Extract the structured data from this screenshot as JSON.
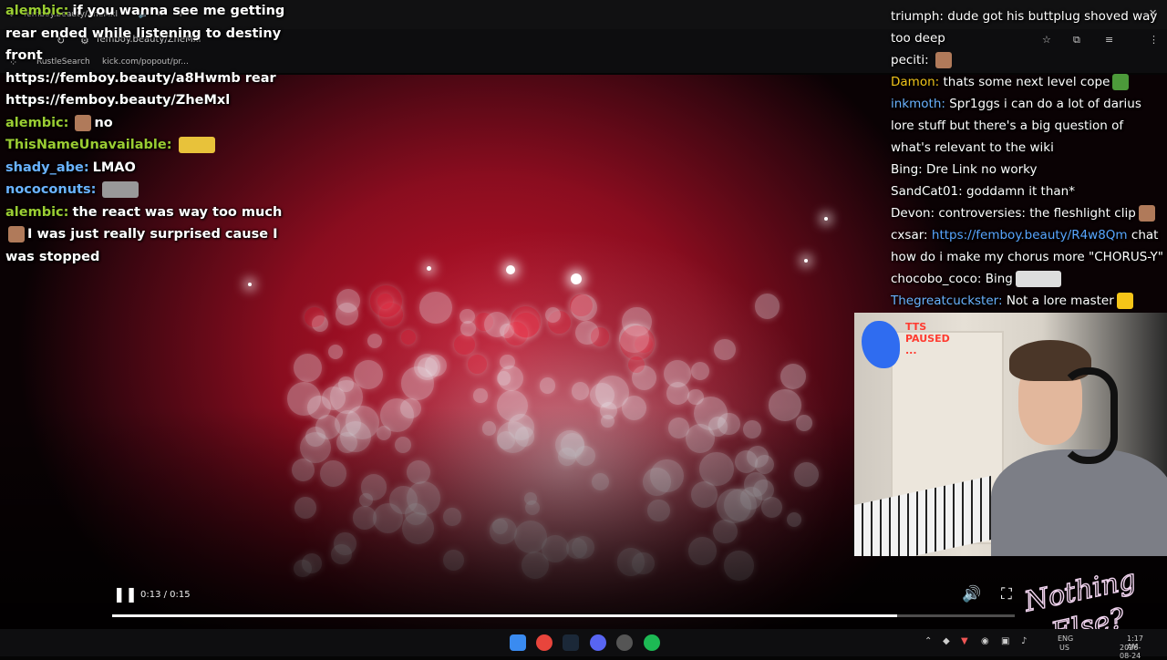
{
  "browser": {
    "tab_title": "femboy.beauty/ZheMxl",
    "url": "femboy.beauty/ZheMxl",
    "bookmarks": [
      "RustleSearch",
      "kick.com/popout/pr..."
    ]
  },
  "left_chat": [
    {
      "user": "alembic:",
      "user_color": "#9acd32",
      "text": "if you wanna see me getting rear ended while listening to destiny front",
      "emote": null
    },
    {
      "user": "",
      "user_color": "#ffffff",
      "text": "https://femboy.beauty/a8Hwmb rear https://femboy.beauty/ZheMxl",
      "emote": null
    },
    {
      "user": "alembic:",
      "user_color": "#9acd32",
      "text": "no",
      "emote": "face-emote"
    },
    {
      "user": "ThisNameUnavailable:",
      "user_color": "#9acd32",
      "text": "",
      "emote": "car-emote"
    },
    {
      "user": "shady_abe:",
      "user_color": "#6ab3ff",
      "text": "LMAO",
      "emote": null
    },
    {
      "user": "nococonuts:",
      "user_color": "#6ab3ff",
      "text": "",
      "emote": "wave-emote"
    },
    {
      "user": "alembic:",
      "user_color": "#9acd32",
      "text": "the react was way too much",
      "emote": null
    },
    {
      "user": "",
      "user_color": "#ffffff",
      "text": "I was just really surprised cause I was stopped",
      "emote": "face-emote"
    }
  ],
  "right_chat": [
    {
      "user": "triumph:",
      "user_color": "#ffffff",
      "text": "dude got his buttplug shoved way too deep",
      "link": ""
    },
    {
      "user": "peciti:",
      "user_color": "#ffffff",
      "text": "",
      "link": "",
      "emote": "face-emote"
    },
    {
      "user": "Damon:",
      "user_color": "#f0c419",
      "text": "thats some next level cope",
      "link": "",
      "emote": "pepe-emote"
    },
    {
      "user": "inkmoth:",
      "user_color": "#6ab3ff",
      "text": "Spr1ggs i can do a lot of darius lore stuff but there's a big question of what's relevant to the wiki",
      "link": ""
    },
    {
      "user": "Bing:",
      "user_color": "#ffffff",
      "text": "Dre Link no worky",
      "link": ""
    },
    {
      "user": "SandCat01:",
      "user_color": "#ffffff",
      "text": "goddamn it than*",
      "link": ""
    },
    {
      "user": "Devon:",
      "user_color": "#ffffff",
      "text": "controversies: the fleshlight clip",
      "link": "",
      "emote": "face-emote"
    },
    {
      "user": "cxsar:",
      "user_color": "#ffffff",
      "text": "chat how do i make my chorus more \"CHORUS-Y\"",
      "link": "https://femboy.beauty/R4w8Qm"
    },
    {
      "user": "chocobo_coco:",
      "user_color": "#ffffff",
      "text": "Bing",
      "link": "",
      "emote": "wings-emote"
    },
    {
      "user": "Thegreatcuckster:",
      "user_color": "#6ab3ff",
      "text": "Not a lore master",
      "link": "",
      "emote": "duck-emote"
    }
  ],
  "tts": {
    "line1": "TTS",
    "line2": "PAUSED",
    "line3": "..."
  },
  "player": {
    "current_time": "0:13",
    "duration": "0:15",
    "progress": 0.87,
    "time_label": "0:13 / 0:15"
  },
  "brand": {
    "line1": "Nothing",
    "line2": "Else?"
  },
  "taskbar": {
    "lang": "ENG",
    "region": "US",
    "time": "1:17 AM",
    "date": "2026-08-24"
  },
  "colors": {
    "accent_link": "#58a6ff",
    "tts_text": "#ff3b30"
  }
}
